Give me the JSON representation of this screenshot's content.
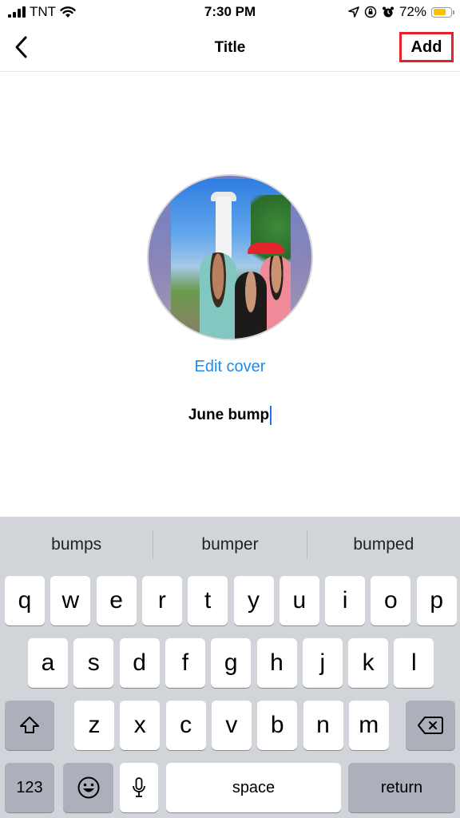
{
  "status_bar": {
    "carrier": "TNT",
    "time": "7:30 PM",
    "battery_percent": "72%",
    "battery_level": 0.72,
    "battery_color": "#f5c400",
    "icons": [
      "signal-icon",
      "wifi-icon",
      "location-icon",
      "orientation-lock-icon",
      "alarm-icon",
      "battery-icon"
    ]
  },
  "nav": {
    "title": "Title",
    "back_icon": "chevron-left-icon",
    "add_label": "Add",
    "highlight_color": "#e8202a"
  },
  "cover": {
    "edit_label": "Edit cover",
    "accent_color": "#1a8cf0"
  },
  "title_field": {
    "value": "June bump"
  },
  "keyboard": {
    "suggestions": [
      "bumps",
      "bumper",
      "bumped"
    ],
    "row1": [
      "q",
      "w",
      "e",
      "r",
      "t",
      "y",
      "u",
      "i",
      "o",
      "p"
    ],
    "row2": [
      "a",
      "s",
      "d",
      "f",
      "g",
      "h",
      "j",
      "k",
      "l"
    ],
    "row3": [
      "z",
      "x",
      "c",
      "v",
      "b",
      "n",
      "m"
    ],
    "numbers_label": "123",
    "space_label": "space",
    "return_label": "return"
  }
}
